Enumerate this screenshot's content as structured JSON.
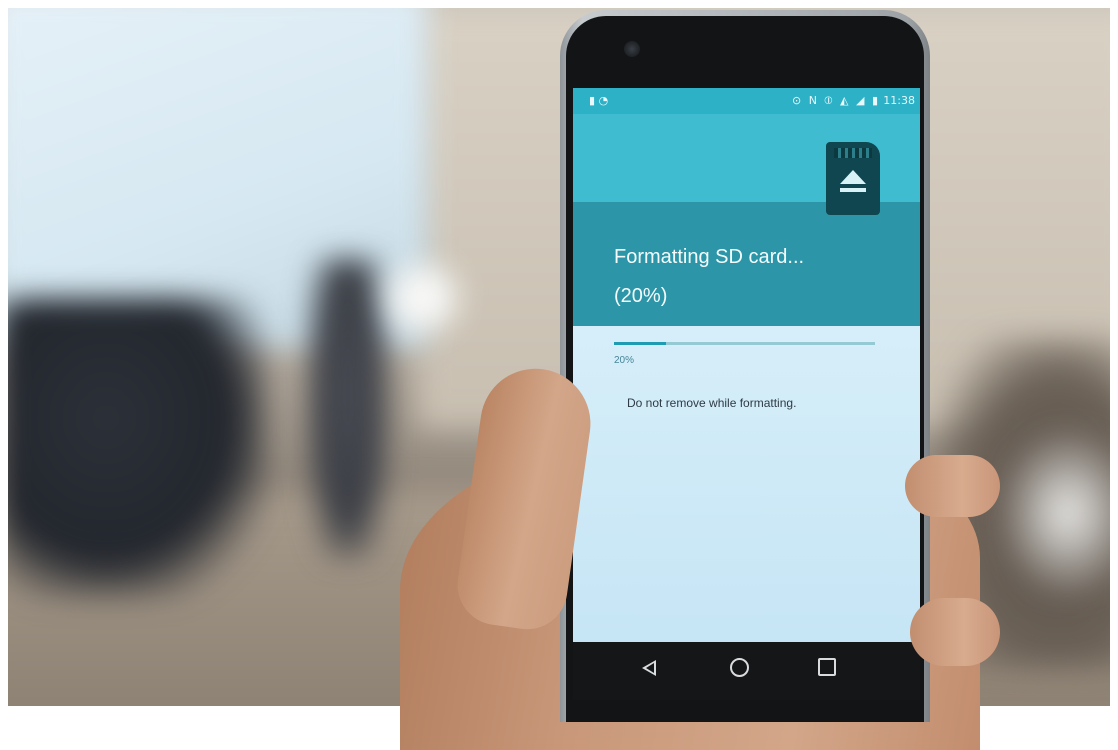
{
  "status_bar": {
    "left_icons": [
      "sd-card-icon",
      "signal-icon"
    ],
    "right_icons": [
      "alarm-icon",
      "nfc-icon",
      "vibrate-icon",
      "wifi-icon",
      "cellular-icon",
      "battery-icon"
    ],
    "time": "11:38"
  },
  "dialog": {
    "icon": "sd-card-eject-icon",
    "title_line1": "Formatting SD card...",
    "title_line2": "(20%)",
    "progress_percent": 20,
    "progress_label": "20%",
    "message": "Do not remove while formatting."
  },
  "navigation": {
    "back": "back-icon",
    "home": "home-icon",
    "recents": "recents-icon"
  },
  "colors": {
    "status_bar": "#2db1c6",
    "header_top": "#3fbccf",
    "header_main": "#2c96a8",
    "content": "#d6eef9",
    "progress_fill": "#1f9cb1"
  }
}
